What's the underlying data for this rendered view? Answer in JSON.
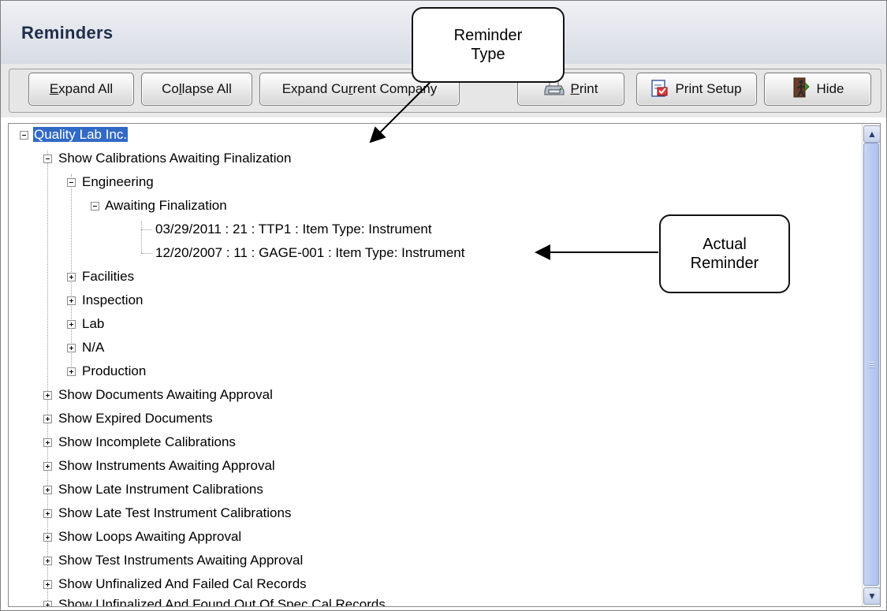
{
  "panel": {
    "title": "Reminders"
  },
  "toolbar": {
    "expand_all": {
      "pre": "",
      "key": "E",
      "post": "xpand All"
    },
    "collapse_all": {
      "pre": "Co",
      "key": "l",
      "post": "lapse All"
    },
    "expand_current": {
      "pre": "Expand Cu",
      "key": "r",
      "post": "rent Company"
    },
    "print": {
      "pre": "",
      "key": "P",
      "post": "rint"
    },
    "print_setup": "Print Setup",
    "hide": "Hide"
  },
  "icons": {
    "print": "printer-icon",
    "print_setup": "print-setup-icon",
    "hide": "door-exit-icon",
    "collapse": "minus-box-icon",
    "expand": "plus-box-icon"
  },
  "tree": {
    "root": "Quality Lab Inc.",
    "calibrations_awaiting": "Show Calibrations Awaiting Finalization",
    "engineering": "Engineering",
    "awaiting_finalization": "Awaiting Finalization",
    "reminders": [
      "03/29/2011 : 21 : TTP1 : Item Type: Instrument",
      "12/20/2007 : 11 : GAGE-001 : Item Type: Instrument"
    ],
    "departments": [
      "Facilities",
      "Inspection",
      "Lab",
      "N/A",
      "Production"
    ],
    "reminder_types": [
      "Show Documents Awaiting Approval",
      "Show Expired Documents",
      "Show Incomplete Calibrations",
      "Show Instruments Awaiting Approval",
      "Show Late Instrument Calibrations",
      "Show Late Test Instrument Calibrations",
      "Show Loops Awaiting Approval",
      "Show Test Instruments Awaiting Approval",
      "Show Unfinalized And Failed Cal Records",
      "Show Unfinalized And Found Out Of Spec Cal Records"
    ]
  },
  "annotations": {
    "reminder_type": [
      "Reminder",
      "Type"
    ],
    "actual_reminder": [
      "Actual",
      "Reminder"
    ]
  },
  "colors": {
    "selection": "#316ac5",
    "title_text": "#1e2d4a",
    "scroll_thumb": "#b9cbf0"
  }
}
